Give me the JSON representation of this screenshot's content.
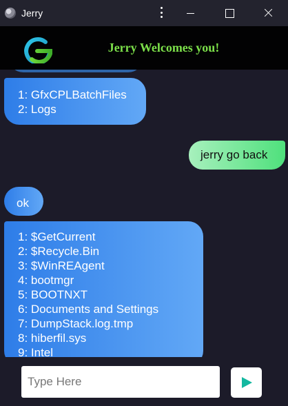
{
  "window": {
    "title": "Jerry",
    "icon": "globe-icon"
  },
  "header": {
    "logo": "g-logo-icon",
    "welcome": "Jerry Welcomes you!"
  },
  "messages": [
    {
      "from": "bot",
      "lines": [
        "1: GfxCPLBatchFiles",
        "2: Logs"
      ]
    },
    {
      "from": "user",
      "text": "jerry go back"
    },
    {
      "from": "bot",
      "text": "ok"
    },
    {
      "from": "bot",
      "lines": [
        "1: $GetCurrent",
        "2: $Recycle.Bin",
        "3: $WinREAgent",
        "4: bootmgr",
        "5: BOOTNXT",
        "6: Documents and Settings",
        "7: DumpStack.log.tmp",
        "8: hiberfil.sys",
        "9: Intel"
      ]
    }
  ],
  "composer": {
    "placeholder": "Type Here",
    "value": "",
    "send_icon": "send-play-icon"
  },
  "colors": {
    "background": "#1c1b29",
    "bot_bubble": "#3d8ff0",
    "user_bubble": "#62e68c",
    "welcome_text": "#7ce04a",
    "send_icon": "#14b8a0"
  }
}
